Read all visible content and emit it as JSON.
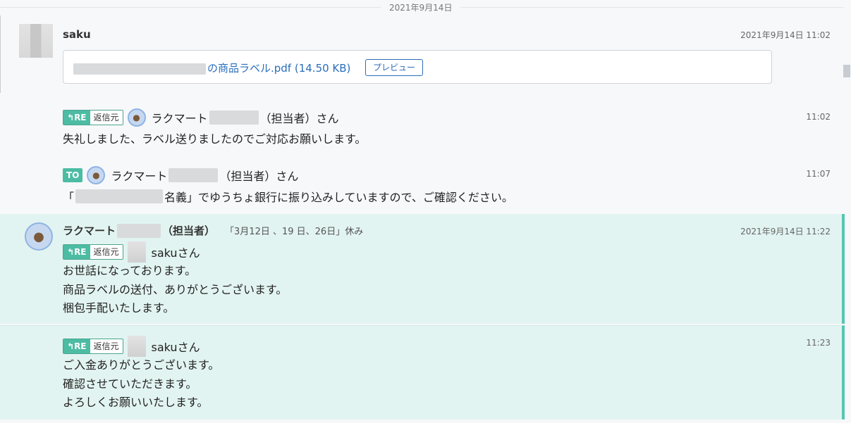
{
  "date_divider": "2021年9月14日",
  "messages": [
    {
      "sender": "saku",
      "time": "2021年9月14日 11:02",
      "file": {
        "name": "の商品ラベル.pdf (14.50 KB)",
        "preview_label": "プレビュー"
      }
    },
    {
      "tag": "RE",
      "tag_sub": "返信元",
      "recipient_prefix": "ラクマート",
      "recipient_suffix": "（担当者）さん",
      "time": "11:02",
      "text": "失礼しました、ラベル送りましたのでご対応お願いします。"
    },
    {
      "tag": "TO",
      "recipient_prefix": "ラクマート",
      "recipient_suffix": "（担当者）さん",
      "time": "11:07",
      "text_prefix": "「",
      "text_suffix": "名義」でゆうちょ銀行に振り込みしていますので、ご確認ください。"
    },
    {
      "sender_prefix": "ラクマート",
      "sender_suffix": "（担当者）",
      "sender_note": "「3月12日 、19 日、26日」休み",
      "time": "2021年9月14日 11:22",
      "tag": "RE",
      "tag_sub": "返信元",
      "recipient": "sakuさん",
      "text": "お世話になっております。\n商品ラベルの送付、ありがとうございます。\n梱包手配いたします。"
    },
    {
      "tag": "RE",
      "tag_sub": "返信元",
      "recipient": "sakuさん",
      "time": "11:23",
      "text": "ご入金ありがとうございます。\n確認させていただきます。\nよろしくお願いいたします。"
    }
  ],
  "colors": {
    "accent": "#4cbca3",
    "highlight_bg": "#e2f4f1",
    "link": "#2a6ebb"
  }
}
